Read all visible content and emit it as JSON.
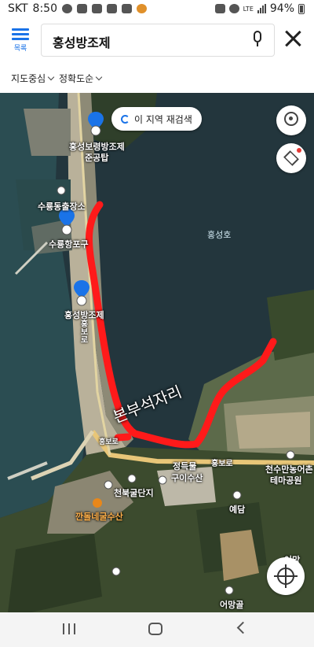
{
  "status": {
    "carrier": "SKT",
    "time": "8:50",
    "network": "LTE",
    "battery": "94%"
  },
  "search": {
    "menu_label": "목록",
    "query": "홍성방조제"
  },
  "filters": [
    {
      "label": "지도중심"
    },
    {
      "label": "정확도순"
    }
  ],
  "map": {
    "rescan_label": "이 지역 재검색",
    "water_label": "홍성호",
    "annotation": "본부석자리",
    "places": {
      "dam_tower": "홍성보령방조제",
      "dam_tower_2": "준공탑",
      "fish_market": "수룡동출장소",
      "port": "수룡항포구",
      "dam": "홍성방조제",
      "road_v": "홍보로",
      "road_h": "홍보로",
      "ferry": "정득물",
      "seafood": "구이수산",
      "cheonbuk": "천북굴단지",
      "kkanti": "깐돌네굴수산",
      "farm": "천수만농어촌",
      "farm_2": "테마공원",
      "yedam": "예담",
      "eomang": "어망",
      "eomang_gol": "어망골",
      "road_small": "홍보로"
    },
    "accent_color": "#ff1a1a"
  }
}
